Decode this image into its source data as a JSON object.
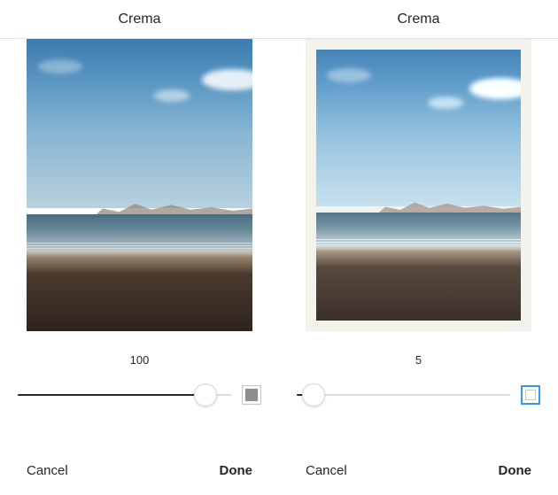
{
  "left": {
    "filter_name": "Crema",
    "slider_value": "100",
    "slider_percent": 100,
    "frame_enabled": false,
    "cancel_label": "Cancel",
    "done_label": "Done"
  },
  "right": {
    "filter_name": "Crema",
    "slider_value": "5",
    "slider_percent": 5,
    "frame_enabled": true,
    "cancel_label": "Cancel",
    "done_label": "Done"
  }
}
